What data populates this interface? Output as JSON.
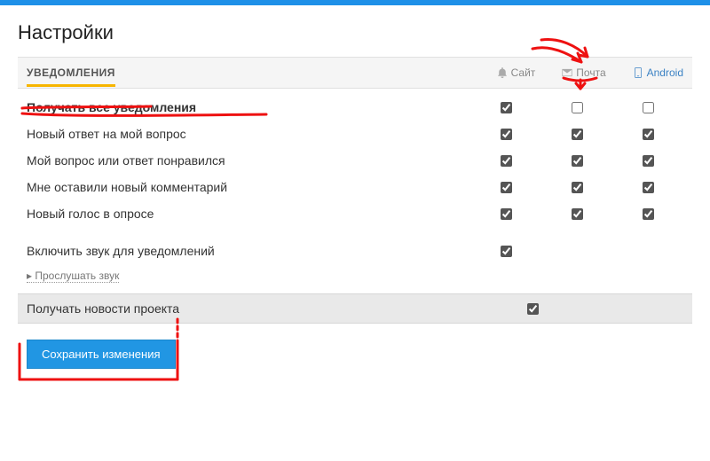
{
  "page": {
    "title": "Настройки"
  },
  "section": {
    "tab_label": "УВЕДОМЛЕНИЯ",
    "channels": {
      "site": "Сайт",
      "mail": "Почта",
      "android": "Android"
    }
  },
  "rows": [
    {
      "label": "Получать все уведомления",
      "bold": true,
      "site": true,
      "mail": false,
      "android": false,
      "android_enabled": true
    },
    {
      "label": "Новый ответ на мой вопрос",
      "site": true,
      "mail": true,
      "android": true
    },
    {
      "label": "Мой вопрос или ответ понравился",
      "site": true,
      "mail": true,
      "android": true
    },
    {
      "label": "Мне оставили новый комментарий",
      "site": true,
      "mail": true,
      "android": true
    },
    {
      "label": "Новый голос в опросе",
      "site": true,
      "mail": true,
      "android": true
    }
  ],
  "sound": {
    "enable_label": "Включить звук для уведомлений",
    "enabled": true,
    "listen_label": "Прослушать звук"
  },
  "news": {
    "label": "Получать новости проекта",
    "checked": true
  },
  "buttons": {
    "save": "Сохранить изменения"
  }
}
